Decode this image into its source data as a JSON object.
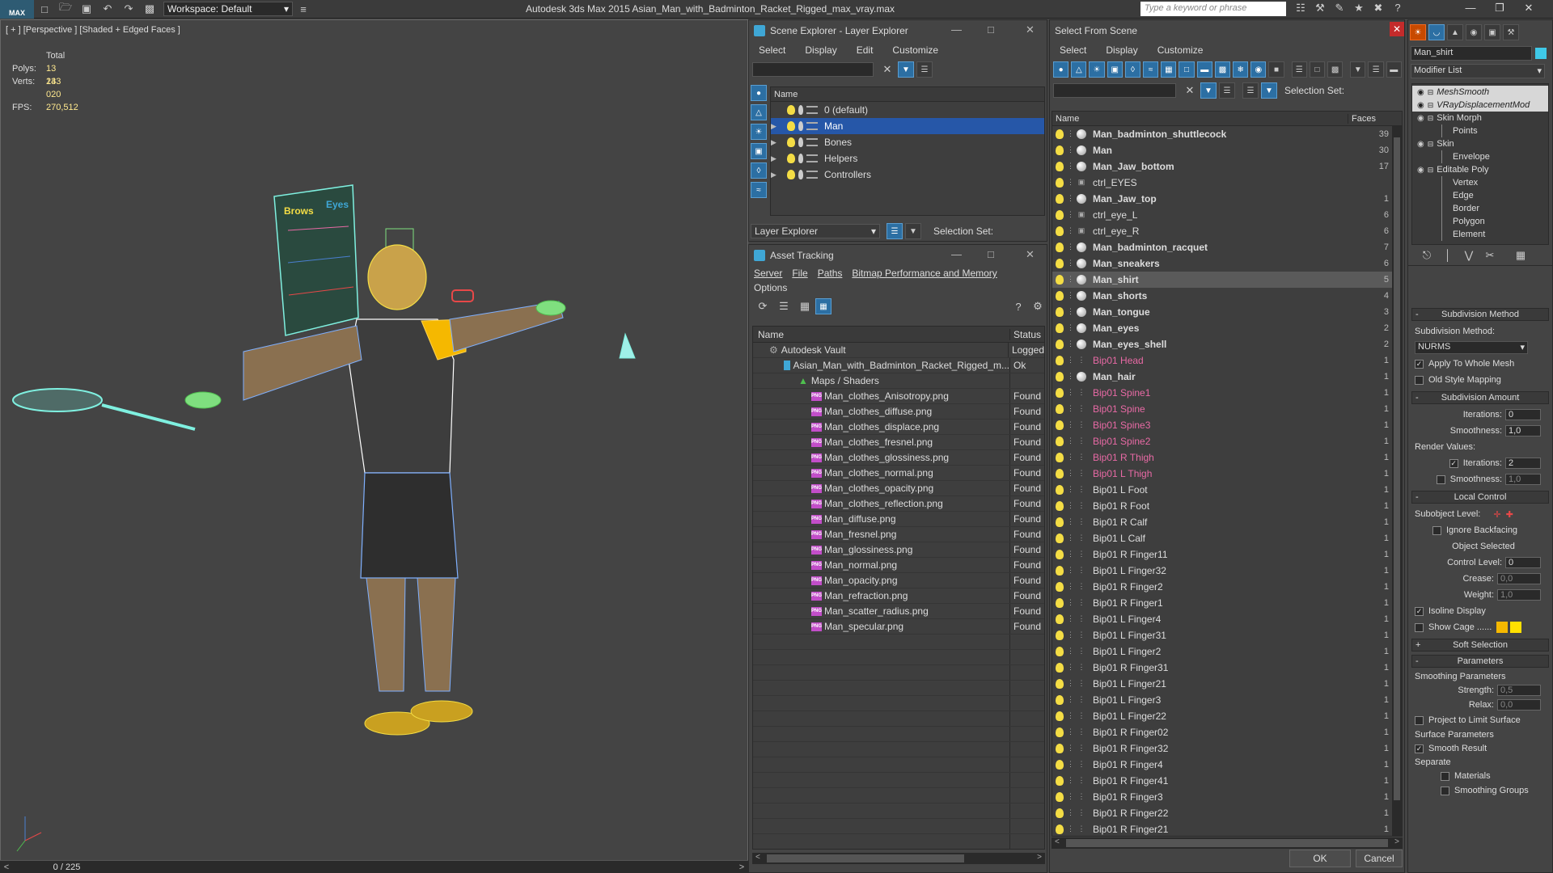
{
  "app": {
    "title": "Autodesk 3ds Max  2015    Asian_Man_with_Badminton_Racket_Rigged_max_vray.max",
    "logo": "MAX",
    "workspace_label": "Workspace: Default",
    "search_placeholder": "Type a keyword or phrase"
  },
  "viewport": {
    "label": "[ + ] [Perspective ] [Shaded + Edged Faces ]",
    "stats_total": "Total",
    "polys_label": "Polys:",
    "polys_value": "13 233",
    "verts_label": "Verts:",
    "verts_value": "14 020",
    "fps_label": "FPS:",
    "fps_value": "270,512",
    "board_brows": "Brows",
    "board_eyes": "Eyes",
    "timeline": "0 / 225"
  },
  "scene_explorer": {
    "title": "Scene Explorer - Layer Explorer",
    "menu": [
      "Select",
      "Display",
      "Edit",
      "Customize"
    ],
    "col_name": "Name",
    "layers": [
      {
        "name": "0 (default)",
        "selected": false,
        "expandable": false
      },
      {
        "name": "Man",
        "selected": true,
        "expandable": true
      },
      {
        "name": "Bones",
        "selected": false,
        "expandable": true
      },
      {
        "name": "Helpers",
        "selected": false,
        "expandable": true
      },
      {
        "name": "Controllers",
        "selected": false,
        "expandable": true
      }
    ],
    "footer_dropdown": "Layer Explorer",
    "selection_set": "Selection Set:"
  },
  "asset_tracking": {
    "title": "Asset Tracking",
    "menu": [
      "Server",
      "File",
      "Paths",
      "Bitmap Performance and Memory"
    ],
    "menu2": "Options",
    "col_name": "Name",
    "col_status": "Status",
    "vault": {
      "name": "Autodesk Vault",
      "status": "Logged"
    },
    "file": {
      "name": "Asian_Man_with_Badminton_Racket_Rigged_m...",
      "status": "Ok"
    },
    "maps": "Maps / Shaders",
    "files": [
      {
        "name": "Man_clothes_Anisotropy.png",
        "status": "Found"
      },
      {
        "name": "Man_clothes_diffuse.png",
        "status": "Found"
      },
      {
        "name": "Man_clothes_displace.png",
        "status": "Found"
      },
      {
        "name": "Man_clothes_fresnel.png",
        "status": "Found"
      },
      {
        "name": "Man_clothes_glossiness.png",
        "status": "Found"
      },
      {
        "name": "Man_clothes_normal.png",
        "status": "Found"
      },
      {
        "name": "Man_clothes_opacity.png",
        "status": "Found"
      },
      {
        "name": "Man_clothes_reflection.png",
        "status": "Found"
      },
      {
        "name": "Man_diffuse.png",
        "status": "Found"
      },
      {
        "name": "Man_fresnel.png",
        "status": "Found"
      },
      {
        "name": "Man_glossiness.png",
        "status": "Found"
      },
      {
        "name": "Man_normal.png",
        "status": "Found"
      },
      {
        "name": "Man_opacity.png",
        "status": "Found"
      },
      {
        "name": "Man_refraction.png",
        "status": "Found"
      },
      {
        "name": "Man_scatter_radius.png",
        "status": "Found"
      },
      {
        "name": "Man_specular.png",
        "status": "Found"
      }
    ],
    "png_tag": "PNG"
  },
  "select_from_scene": {
    "title": "Select From Scene",
    "menu": [
      "Select",
      "Display",
      "Customize"
    ],
    "selection_set": "Selection Set:",
    "col_name": "Name",
    "col_faces": "Faces",
    "objects": [
      {
        "name": "Man_badminton_shuttlecock",
        "kind": "mesh",
        "faces": "39"
      },
      {
        "name": "Man",
        "kind": "mesh",
        "faces": "30"
      },
      {
        "name": "Man_Jaw_bottom",
        "kind": "mesh",
        "faces": "17"
      },
      {
        "name": "ctrl_EYES",
        "kind": "helper",
        "faces": ""
      },
      {
        "name": "Man_Jaw_top",
        "kind": "mesh",
        "faces": "1"
      },
      {
        "name": "ctrl_eye_L",
        "kind": "helper",
        "faces": "6"
      },
      {
        "name": "ctrl_eye_R",
        "kind": "helper",
        "faces": "6"
      },
      {
        "name": "Man_badminton_racquet",
        "kind": "mesh",
        "faces": "7"
      },
      {
        "name": "Man_sneakers",
        "kind": "mesh",
        "faces": "6"
      },
      {
        "name": "Man_shirt",
        "kind": "mesh",
        "faces": "5",
        "highlight": true
      },
      {
        "name": "Man_shorts",
        "kind": "mesh",
        "faces": "4"
      },
      {
        "name": "Man_tongue",
        "kind": "mesh",
        "faces": "3"
      },
      {
        "name": "Man_eyes",
        "kind": "mesh",
        "faces": "2"
      },
      {
        "name": "Man_eyes_shell",
        "kind": "mesh",
        "faces": "2"
      },
      {
        "name": "Bip01 Head",
        "kind": "bone",
        "faces": "1"
      },
      {
        "name": "Man_hair",
        "kind": "mesh",
        "faces": "1"
      },
      {
        "name": "Bip01 Spine1",
        "kind": "bone",
        "faces": "1"
      },
      {
        "name": "Bip01 Spine",
        "kind": "bone",
        "faces": "1"
      },
      {
        "name": "Bip01 Spine3",
        "kind": "bone",
        "faces": "1"
      },
      {
        "name": "Bip01 Spine2",
        "kind": "bone",
        "faces": "1"
      },
      {
        "name": "Bip01 R Thigh",
        "kind": "bone",
        "faces": "1"
      },
      {
        "name": "Bip01 L Thigh",
        "kind": "bone",
        "faces": "1"
      },
      {
        "name": "Bip01 L Foot",
        "kind": "bip",
        "faces": "1"
      },
      {
        "name": "Bip01 R Foot",
        "kind": "bip",
        "faces": "1"
      },
      {
        "name": "Bip01 R Calf",
        "kind": "bip",
        "faces": "1"
      },
      {
        "name": "Bip01 L Calf",
        "kind": "bip",
        "faces": "1"
      },
      {
        "name": "Bip01 R Finger11",
        "kind": "bip",
        "faces": "1"
      },
      {
        "name": "Bip01 L Finger32",
        "kind": "bip",
        "faces": "1"
      },
      {
        "name": "Bip01 R Finger2",
        "kind": "bip",
        "faces": "1"
      },
      {
        "name": "Bip01 R Finger1",
        "kind": "bip",
        "faces": "1"
      },
      {
        "name": "Bip01 L Finger4",
        "kind": "bip",
        "faces": "1"
      },
      {
        "name": "Bip01 L Finger31",
        "kind": "bip",
        "faces": "1"
      },
      {
        "name": "Bip01 L Finger2",
        "kind": "bip",
        "faces": "1"
      },
      {
        "name": "Bip01 R Finger31",
        "kind": "bip",
        "faces": "1"
      },
      {
        "name": "Bip01 L Finger21",
        "kind": "bip",
        "faces": "1"
      },
      {
        "name": "Bip01 L Finger3",
        "kind": "bip",
        "faces": "1"
      },
      {
        "name": "Bip01 L Finger22",
        "kind": "bip",
        "faces": "1"
      },
      {
        "name": "Bip01 R Finger02",
        "kind": "bip",
        "faces": "1"
      },
      {
        "name": "Bip01 R Finger32",
        "kind": "bip",
        "faces": "1"
      },
      {
        "name": "Bip01 R Finger4",
        "kind": "bip",
        "faces": "1"
      },
      {
        "name": "Bip01 R Finger41",
        "kind": "bip",
        "faces": "1"
      },
      {
        "name": "Bip01 R Finger3",
        "kind": "bip",
        "faces": "1"
      },
      {
        "name": "Bip01 R Finger22",
        "kind": "bip",
        "faces": "1"
      },
      {
        "name": "Bip01 R Finger21",
        "kind": "bip",
        "faces": "1"
      }
    ],
    "ok": "OK",
    "cancel": "Cancel"
  },
  "modifier": {
    "object_name": "Man_shirt",
    "list_label": "Modifier List",
    "stack": [
      {
        "name": "MeshSmooth",
        "level": 0,
        "italic": true,
        "highlight": true
      },
      {
        "name": "VRayDisplacementMod",
        "level": 0,
        "italic": true,
        "highlight": true
      },
      {
        "name": "Skin Morph",
        "level": 0,
        "italic": false,
        "highlight": false
      },
      {
        "name": "Points",
        "level": 1,
        "italic": false,
        "highlight": false
      },
      {
        "name": "Skin",
        "level": 0,
        "italic": false,
        "highlight": false
      },
      {
        "name": "Envelope",
        "level": 1,
        "italic": false,
        "highlight": false
      },
      {
        "name": "Editable Poly",
        "level": 0,
        "italic": false,
        "highlight": false
      },
      {
        "name": "Vertex",
        "level": 1,
        "italic": false,
        "highlight": false
      },
      {
        "name": "Edge",
        "level": 1,
        "italic": false,
        "highlight": false
      },
      {
        "name": "Border",
        "level": 1,
        "italic": false,
        "highlight": false
      },
      {
        "name": "Polygon",
        "level": 1,
        "italic": false,
        "highlight": false
      },
      {
        "name": "Element",
        "level": 1,
        "italic": false,
        "highlight": false
      }
    ],
    "subdivision_method": {
      "title": "Subdivision Method",
      "label": "Subdivision Method:",
      "value": "NURMS",
      "apply_whole": "Apply To Whole Mesh",
      "old_style": "Old Style Mapping"
    },
    "subdivision_amount": {
      "title": "Subdivision Amount",
      "iterations_label": "Iterations:",
      "iterations": "0",
      "smoothness_label": "Smoothness:",
      "smoothness": "1,0",
      "render_values": "Render Values:",
      "r_iterations": "2",
      "r_smoothness": "1,0"
    },
    "local_control": {
      "title": "Local Control",
      "subobject": "Subobject Level:",
      "ignore_backfacing": "Ignore Backfacing",
      "object_selected": "Object Selected",
      "control_level_label": "Control Level:",
      "control_level": "0",
      "crease_label": "Crease:",
      "crease": "0,0",
      "weight_label": "Weight:",
      "weight": "1,0",
      "isoline": "Isoline Display",
      "show_cage": "Show Cage ......"
    },
    "soft_selection": "Soft Selection",
    "parameters": {
      "title": "Parameters",
      "smoothing": "Smoothing Parameters",
      "strength_label": "Strength:",
      "strength": "0,5",
      "relax_label": "Relax:",
      "relax": "0,0",
      "project": "Project to Limit Surface",
      "surface": "Surface Parameters",
      "smooth_result": "Smooth Result",
      "separate": "Separate",
      "materials": "Materials",
      "smoothing_groups": "Smoothing Groups"
    }
  },
  "colors": {
    "accent": "#2657a8",
    "bone": "#e86aa5",
    "bulb": "#f4dd45",
    "cage1": "#f5b800",
    "cage2": "#ffe000"
  }
}
